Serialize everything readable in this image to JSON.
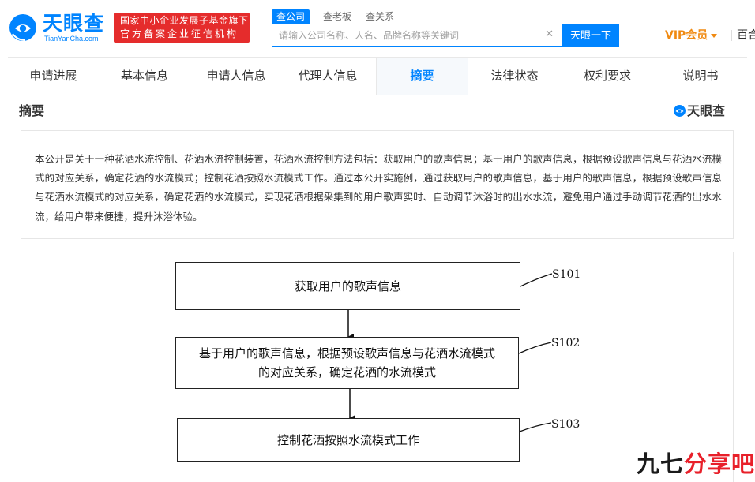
{
  "header": {
    "logo_text": "天眼查",
    "logo_subtext": "TianYanCha.com",
    "badge_line1": "国家中小企业发展子基金旗下",
    "badge_line2": "官方备案企业征信机构",
    "search_tabs": [
      "查公司",
      "查老板",
      "查关系"
    ],
    "search_placeholder": "请输入公司名称、人名、品牌名称等关键词",
    "search_button": "天眼一下",
    "vip_label": "VIP会员",
    "more_nav": "百合",
    "brand_color": "#0084ff",
    "badge_color": "#e52c2c",
    "vip_color": "#f08a12"
  },
  "tabs": [
    {
      "label": "申请进展",
      "active": false
    },
    {
      "label": "基本信息",
      "active": false
    },
    {
      "label": "申请人信息",
      "active": false
    },
    {
      "label": "代理人信息",
      "active": false
    },
    {
      "label": "摘要",
      "active": true
    },
    {
      "label": "法律状态",
      "active": false
    },
    {
      "label": "权利要求",
      "active": false
    },
    {
      "label": "说明书",
      "active": false
    }
  ],
  "section": {
    "title": "摘要",
    "watermark": "天眼查"
  },
  "abstract": "本公开是关于一种花洒水流控制、花洒水流控制装置，花洒水流控制方法包括：获取用户的歌声信息；基于用户的歌声信息，根据预设歌声信息与花洒水流模式的对应关系，确定花洒的水流模式；控制花洒按照水流模式工作。通过本公开实施例，通过获取用户的歌声信息，基于用户的歌声信息，根据预设歌声信息与花洒水流模式的对应关系，确定花洒的水流模式，实现花洒根据采集到的用户歌声实时、自动调节沐浴时的出水水流，避免用户通过手动调节花洒的出水水流，给用户带来便捷，提升沐浴体验。",
  "flowchart": {
    "steps": [
      {
        "id": "S101",
        "lines": [
          "获取用户的歌声信息"
        ]
      },
      {
        "id": "S102",
        "lines": [
          "基于用户的歌声信息，根据预设歌声信息与花洒水流模式",
          "的对应关系，确定花洒的水流模式"
        ]
      },
      {
        "id": "S103",
        "lines": [
          "控制花洒按照水流模式工作"
        ]
      }
    ]
  },
  "corner_watermark": {
    "part1": "九七",
    "part2": "分享吧"
  }
}
